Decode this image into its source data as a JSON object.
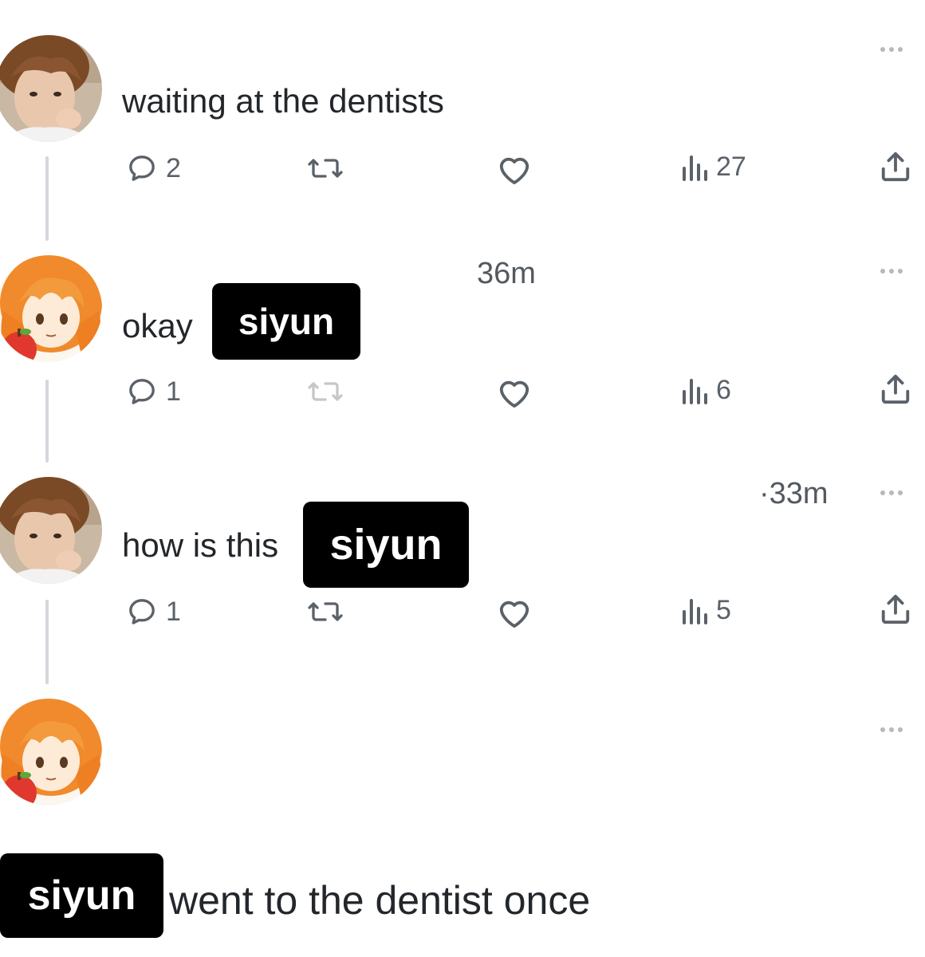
{
  "posts": [
    {
      "text": "waiting at the dentists",
      "replies": "2",
      "views": "27",
      "avatar": "boy-photo"
    },
    {
      "time": "36m",
      "text": "okay",
      "redacted_name": "siyun",
      "replies": "1",
      "views": "6",
      "avatar": "anime-girl"
    },
    {
      "time": "·33m",
      "text": "how is this",
      "redacted_name": "siyun",
      "replies": "1",
      "views": "5",
      "avatar": "boy-photo"
    },
    {
      "avatar": "anime-girl"
    }
  ],
  "caption": {
    "redacted_name": "siyun",
    "text": "went to the dentist once"
  },
  "icons": {
    "reply": "reply-icon",
    "repost": "repost-icon",
    "like": "heart-icon",
    "views": "views-icon",
    "share": "share-icon",
    "more": "more-icon"
  },
  "colors": {
    "text": "#23272b",
    "icon": "#5b6168",
    "thread_line": "#d4d8dc",
    "redaction": "#000000"
  }
}
